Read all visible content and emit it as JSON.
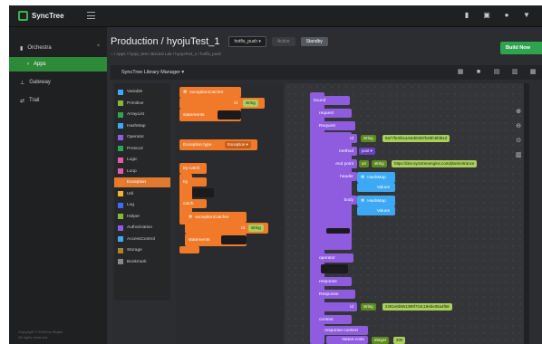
{
  "app": {
    "name": "SyncTree"
  },
  "sidebar": {
    "items": [
      {
        "label": "Orchestra",
        "icon": "bar-chart-icon"
      },
      {
        "label": "Apps",
        "icon": "chevron-right-icon"
      },
      {
        "label": "Gateway",
        "icon": "gateway-icon"
      },
      {
        "label": "Trail",
        "icon": "trail-icon"
      }
    ],
    "footer_1": "Copyright © 2018 by Ntuple",
    "footer_2": "All rights reserved."
  },
  "header": {
    "title": "Production / hyojuTest_1",
    "branch": "hotfix_push ▾",
    "tag_active": "Active",
    "tag_standby": "Standby",
    "breadcrumb": "⌂ / Apps / hyoju_test / BizUnit Lab / hyojuTest_1 / hotfix_push",
    "build_label": "Build Now"
  },
  "library": {
    "title": "SyncTree Library Manager ▾"
  },
  "categories": [
    {
      "label": "Variable",
      "color": "#3da9f5"
    },
    {
      "label": "Primitive",
      "color": "#84b935"
    },
    {
      "label": "ArrayList",
      "color": "#2ea44f"
    },
    {
      "label": "HashMap",
      "color": "#3da9f5"
    },
    {
      "label": "Operator",
      "color": "#8f5ce0"
    },
    {
      "label": "Protocol",
      "color": "#2ea44f"
    },
    {
      "label": "Logic",
      "color": "#e05caa"
    },
    {
      "label": "Loop",
      "color": "#e05caa"
    },
    {
      "label": "Exception",
      "color": "#f07a2a"
    },
    {
      "label": "Util",
      "color": "#f0b52a"
    },
    {
      "label": "Log",
      "color": "#3d6cf5"
    },
    {
      "label": "Helper",
      "color": "#84b935"
    },
    {
      "label": "Authorization",
      "color": "#8f5ce0"
    },
    {
      "label": "AccessControl",
      "color": "#3da9f5"
    },
    {
      "label": "Storage",
      "color": "#b08030"
    },
    {
      "label": "Bookmark",
      "color": "#888888"
    }
  ],
  "flyout": {
    "b1": "exceptionCatcher",
    "b1_id": "id",
    "b1_type": "string",
    "b1_stmt": "statements",
    "b2": "Exception type",
    "b2_val": "Exception ▾",
    "b3": "try-catch",
    "b3_try": "try",
    "b3_catch": "catch",
    "b3_catcher": "exceptionCatcher",
    "b3_id": "id",
    "b3_type": "string",
    "b3_stmt": "statements"
  },
  "canvas": {
    "bound": "bound",
    "request": "request",
    "request2": "Request",
    "id_label": "id",
    "str_label": "string",
    "req_id": "6a77fe4f41a44eb0397b29fc5fd61d",
    "method_label": "method",
    "method_val": "post ▾",
    "endpoint_label": "end point",
    "endpoint_prefix": "uri",
    "endpoint_url": "https://dev.synctreeengine.com/plan/entrance",
    "header_label": "header",
    "header_map": "HashMap",
    "header_key": "Values",
    "body_label": "body",
    "body_map": "HashMap",
    "body_key": "Values",
    "operator": "operator",
    "response": "response",
    "response2": "Response",
    "resp_id": "2291e6b961399f724c19ebe05a4f58",
    "context": "context",
    "resp_context": "response-context",
    "status_code": "status-code",
    "integer_label": "integer",
    "status_val": "200"
  }
}
